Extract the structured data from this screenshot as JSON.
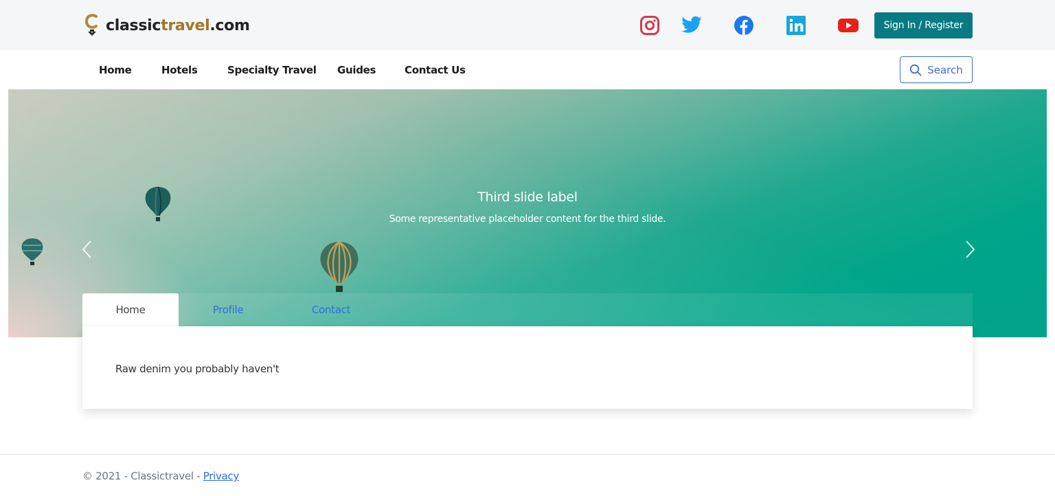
{
  "brand": {
    "part1": "classic",
    "part2": "travel",
    "part3": ".com"
  },
  "social": [
    {
      "name": "instagram-icon",
      "color": "#e1306c"
    },
    {
      "name": "twitter-icon",
      "color": "#1da1f2"
    },
    {
      "name": "facebook-icon",
      "color": "#1877f2"
    },
    {
      "name": "linkedin-icon",
      "color": "#18a6dc"
    },
    {
      "name": "youtube-icon",
      "color": "#e62117"
    }
  ],
  "header": {
    "signin_label": "Sign In / Register"
  },
  "nav": {
    "items": [
      "Home",
      "Hotels",
      "Specialty Travel",
      "Guides",
      "Contact Us"
    ],
    "search_label": "Search"
  },
  "carousel": {
    "title": "Third slide label",
    "subtitle": "Some representative placeholder content for the third slide."
  },
  "tabs": {
    "items": [
      "Home",
      "Profile",
      "Contact"
    ],
    "active": "Home",
    "content": "Raw denim you probably haven't"
  },
  "footer": {
    "copyright": "© 2021 - Classictravel - ",
    "privacy_label": "Privacy"
  },
  "colors": {
    "accent": "#0a7a82",
    "link": "#2f6fe0",
    "hero": "#00a58a"
  }
}
